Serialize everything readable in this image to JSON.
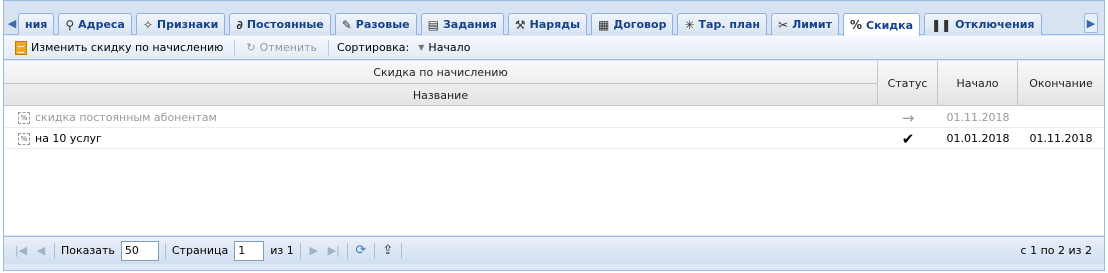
{
  "tabs": [
    {
      "label": "ния",
      "icon": "arrow-left-icon"
    },
    {
      "label": "Адреса",
      "icon": "location-pin-icon"
    },
    {
      "label": "Признаки",
      "icon": "tag-icon"
    },
    {
      "label": "Постоянные",
      "icon": "link-icon"
    },
    {
      "label": "Разовые",
      "icon": "wrench-icon"
    },
    {
      "label": "Задания",
      "icon": "clipboard-icon"
    },
    {
      "label": "Наряды",
      "icon": "tools-icon"
    },
    {
      "label": "Договор",
      "icon": "document-edit-icon"
    },
    {
      "label": "Тар. план",
      "icon": "sparkle-icon"
    },
    {
      "label": "Лимит",
      "icon": "scissors-icon"
    },
    {
      "label": "Скидка",
      "icon": "percent-icon",
      "active": true
    },
    {
      "label": "Отключения",
      "icon": "pause-icon"
    }
  ],
  "toolbar": {
    "edit_label": "Изменить скидку по начислению",
    "cancel_label": "Отменить",
    "sort_label": "Сортировка:",
    "sort_value": "Начало"
  },
  "grid": {
    "group_header": "Скидка по начислению",
    "columns": {
      "name": "Название",
      "status": "Статус",
      "start": "Начало",
      "end": "Окончание"
    },
    "rows": [
      {
        "name": "скидка постоянным абонентам",
        "status": "→",
        "start": "01.11.2018",
        "end": ""
      },
      {
        "name": "на 10 услуг",
        "status": "✔",
        "start": "01.01.2018",
        "end": "01.11.2018"
      }
    ]
  },
  "pager": {
    "show_label": "Показать",
    "page_size": "50",
    "page_label": "Страница",
    "page_value": "1",
    "of_label": "из 1",
    "info": "с 1 по 2 из 2"
  },
  "colors": {
    "tab_text": "#15428b",
    "border": "#99bbe8"
  }
}
